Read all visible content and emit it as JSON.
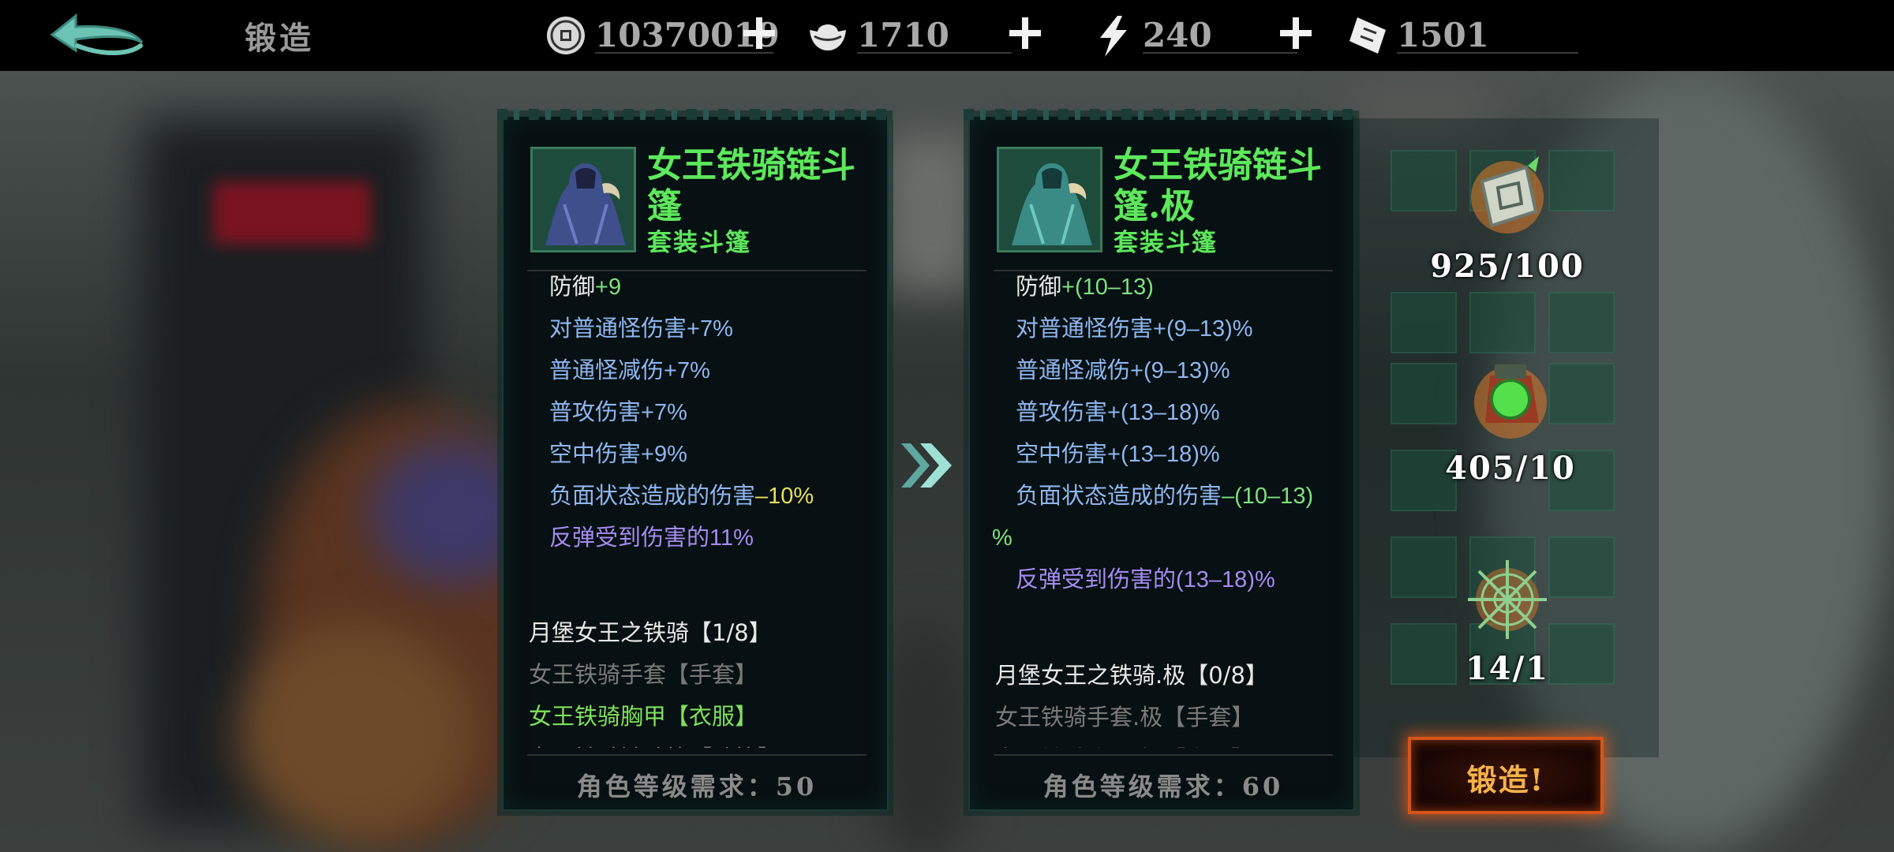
{
  "topbar": {
    "title": "锻造",
    "resources": [
      {
        "name": "coin",
        "value": "10370019"
      },
      {
        "name": "ingot",
        "value": "1710"
      },
      {
        "name": "energy",
        "value": "240"
      },
      {
        "name": "ticket",
        "value": "1501"
      }
    ]
  },
  "colors": {
    "item_name": "#5ee85c",
    "stat_label_white": "#e8e8e8",
    "stat_blue": "#8fb6f0",
    "stat_purple": "#a58cf0",
    "value_green": "#7fe07f",
    "value_yellow": "#e8df5c",
    "set_grey": "#7a7a7a",
    "set_green": "#7fe05c",
    "forge_button": "#d4561a"
  },
  "left_item": {
    "name": "女王铁骑链斗篷",
    "type": "套装斗篷",
    "stats": [
      {
        "label": "防御",
        "value": "+9",
        "label_color": "#e8e8e8",
        "value_color": "#7fe07f"
      },
      {
        "label": "对普通怪伤害",
        "value": "+7%",
        "label_color": "#8fb6f0",
        "value_color": "#8fb6f0"
      },
      {
        "label": "普通怪减伤",
        "value": "+7%",
        "label_color": "#8fb6f0",
        "value_color": "#8fb6f0"
      },
      {
        "label": "普攻伤害",
        "value": "+7%",
        "label_color": "#8fb6f0",
        "value_color": "#8fb6f0"
      },
      {
        "label": "空中伤害",
        "value": "+9%",
        "label_color": "#8fb6f0",
        "value_color": "#8fb6f0"
      },
      {
        "label": "负面状态造成的伤害",
        "value": "–10%",
        "label_color": "#8fb6f0",
        "value_color": "#e8df5c"
      },
      {
        "label": "反弹受到伤害的",
        "value": "11%",
        "label_color": "#a58cf0",
        "value_color": "#a58cf0"
      }
    ],
    "set_title": "月堡女王之铁骑【1/8】",
    "set_items": [
      {
        "text": "女王铁骑手套【手套】",
        "color": "#7a7a7a"
      },
      {
        "text": "女王铁骑胸甲【衣服】",
        "color": "#7fe05c"
      },
      {
        "text": "女王铁骑链斗篷【斗篷】",
        "color": "#7a7a7a"
      }
    ],
    "requirement": "角色等级需求：50"
  },
  "right_item": {
    "name": "女王铁骑链斗篷.极",
    "type": "套装斗篷",
    "stats": [
      {
        "label": "防御",
        "value": "+(10–13)",
        "label_color": "#e8e8e8",
        "value_color": "#7fe07f"
      },
      {
        "label": "对普通怪伤害",
        "value": "+(9–13)%",
        "label_color": "#8fb6f0",
        "value_color": "#8fb6f0"
      },
      {
        "label": "普通怪减伤",
        "value": "+(9–13)%",
        "label_color": "#8fb6f0",
        "value_color": "#8fb6f0"
      },
      {
        "label": "普攻伤害",
        "value": "+(13–18)%",
        "label_color": "#8fb6f0",
        "value_color": "#8fb6f0"
      },
      {
        "label": "空中伤害",
        "value": "+(13–18)%",
        "label_color": "#8fb6f0",
        "value_color": "#8fb6f0"
      },
      {
        "label": "负面状态造成的伤害",
        "value": "–(10–13)",
        "label_color": "#8fb6f0",
        "value_color": "#7fe07f"
      },
      {
        "label": "反弹受到伤害的",
        "value": "(13–18)%",
        "label_color": "#a58cf0",
        "value_color": "#a58cf0"
      }
    ],
    "wrap_percent": "%",
    "set_title": "月堡女王之铁骑.极【0/8】",
    "set_items": [
      {
        "text": "女王铁骑手套.极【手套】",
        "color": "#7a7a7a"
      },
      {
        "text": "女王铁骑胸甲.极【衣服】",
        "color": "#7a7a7a"
      }
    ],
    "requirement": "角色等级需求：60"
  },
  "materials": [
    {
      "name": "rune-fragment",
      "count": "925/100"
    },
    {
      "name": "green-orb-crystal",
      "count": "405/10"
    },
    {
      "name": "spiderweb-essence",
      "count": "14/1"
    }
  ],
  "forge_button": {
    "label": "锻造!"
  }
}
